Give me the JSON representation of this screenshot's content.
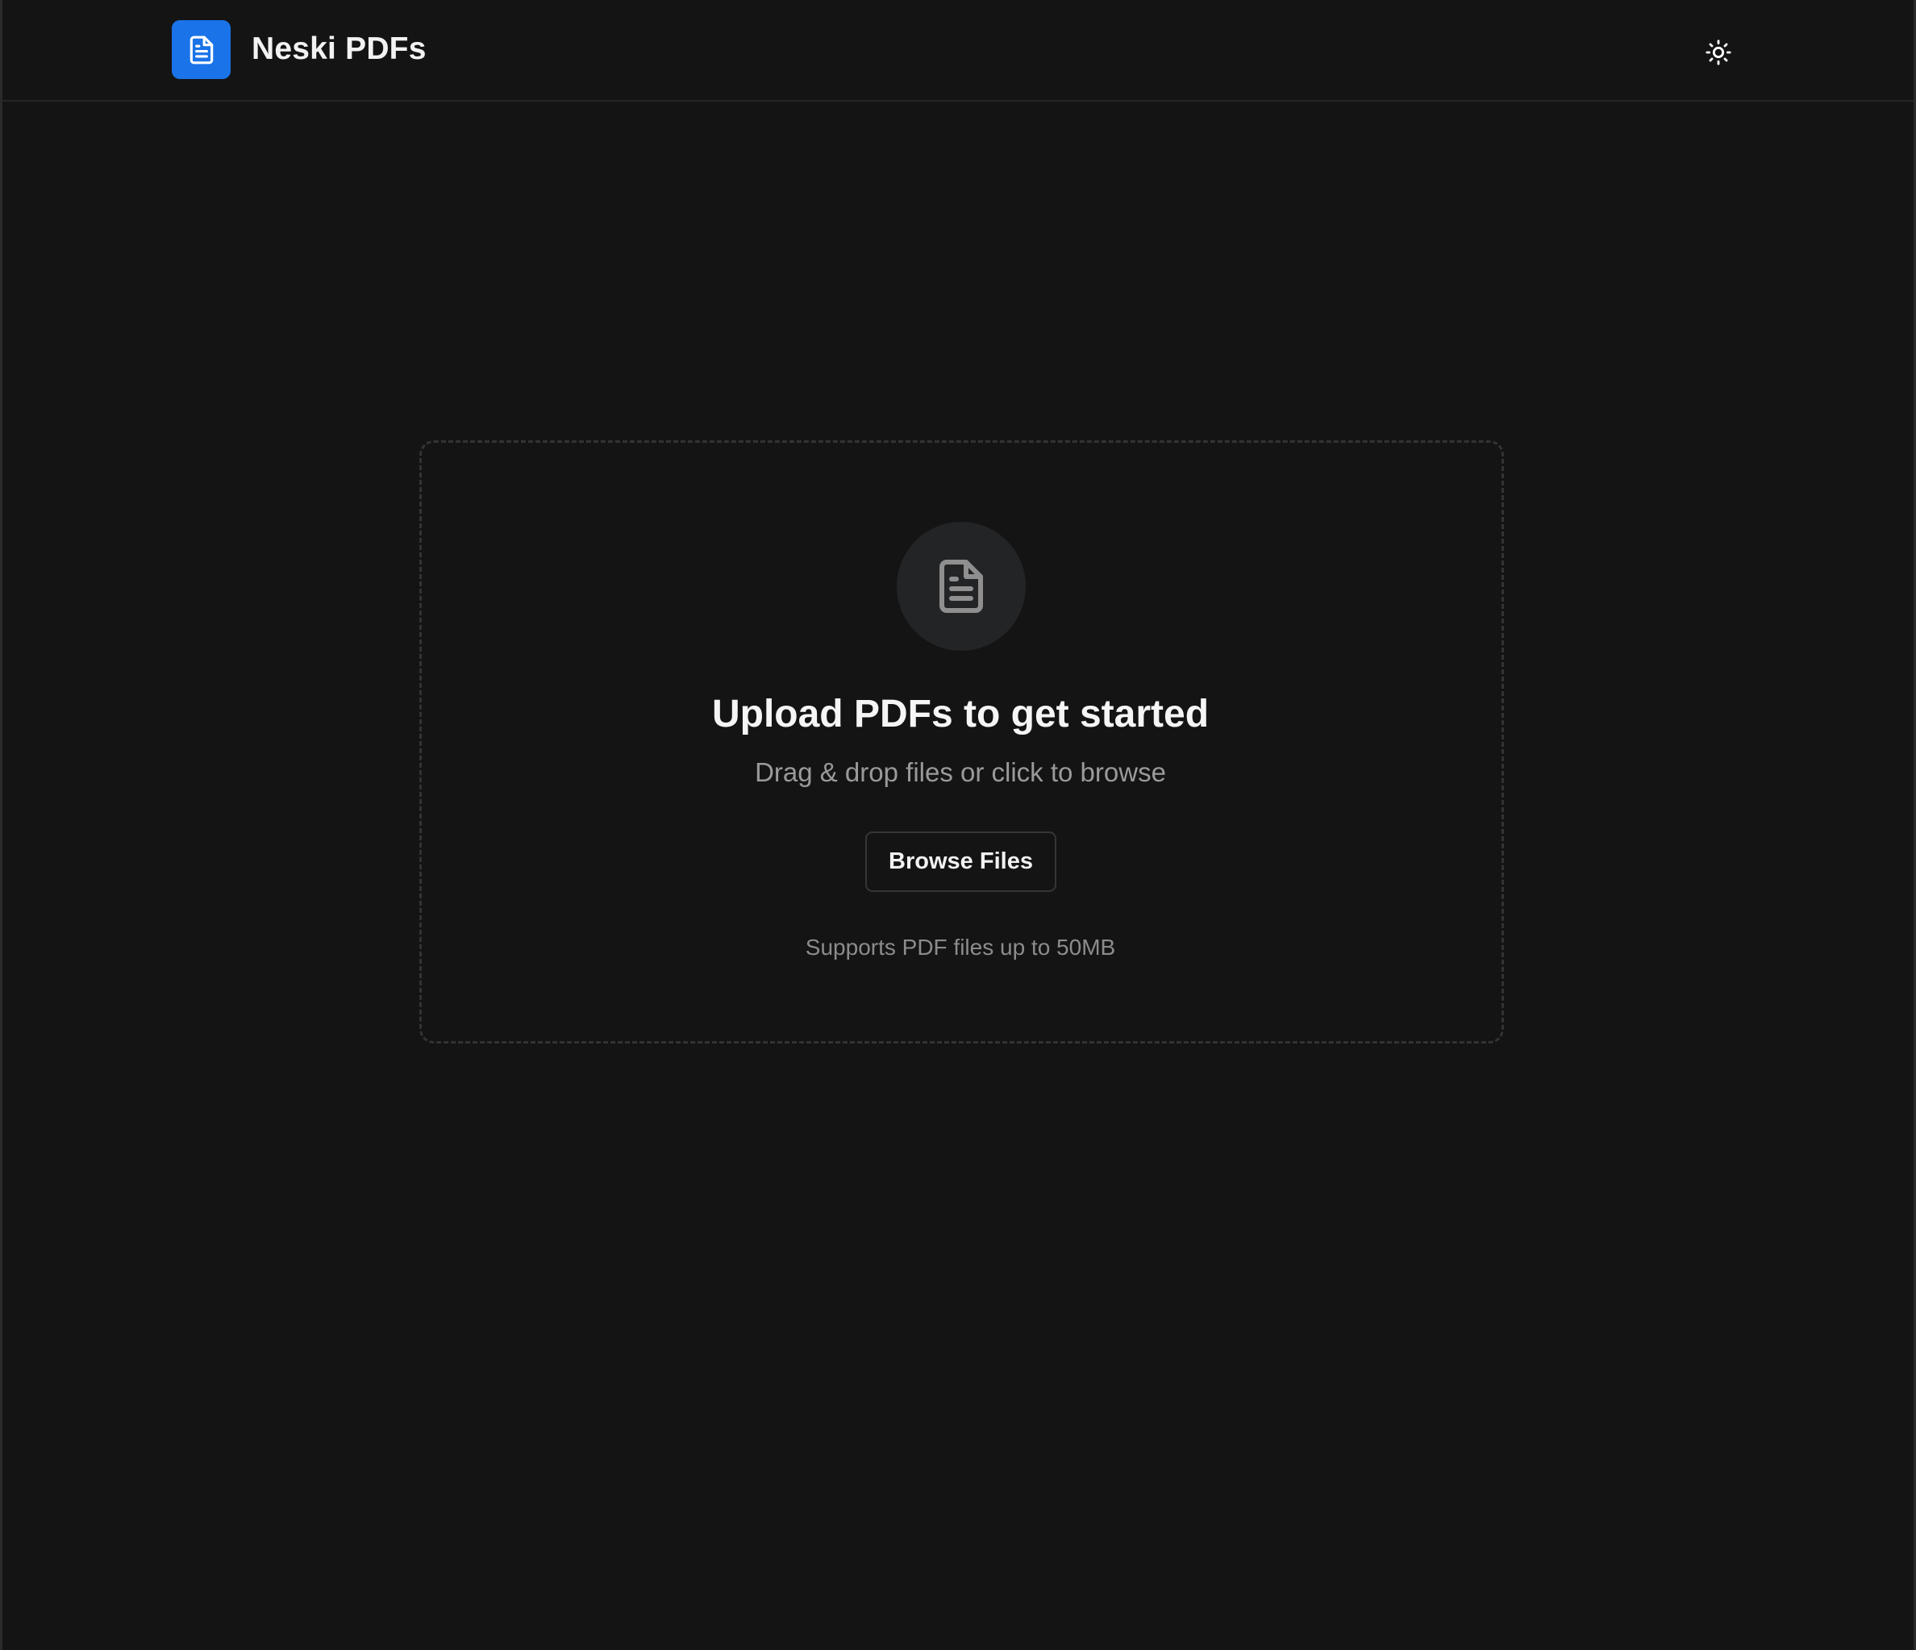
{
  "header": {
    "app_title": "Neski PDFs",
    "logo_icon": "document-icon",
    "theme_toggle_icon": "sun-icon"
  },
  "upload": {
    "icon": "file-text-icon",
    "title": "Upload PDFs to get started",
    "subtitle": "Drag & drop files or click to browse",
    "browse_label": "Browse Files",
    "support_text": "Supports PDF files up to 50MB"
  },
  "colors": {
    "background": "#141414",
    "accent": "#1a73e8",
    "text_primary": "#f5f5f5",
    "text_muted": "#9a9a9a",
    "border": "#333333"
  }
}
